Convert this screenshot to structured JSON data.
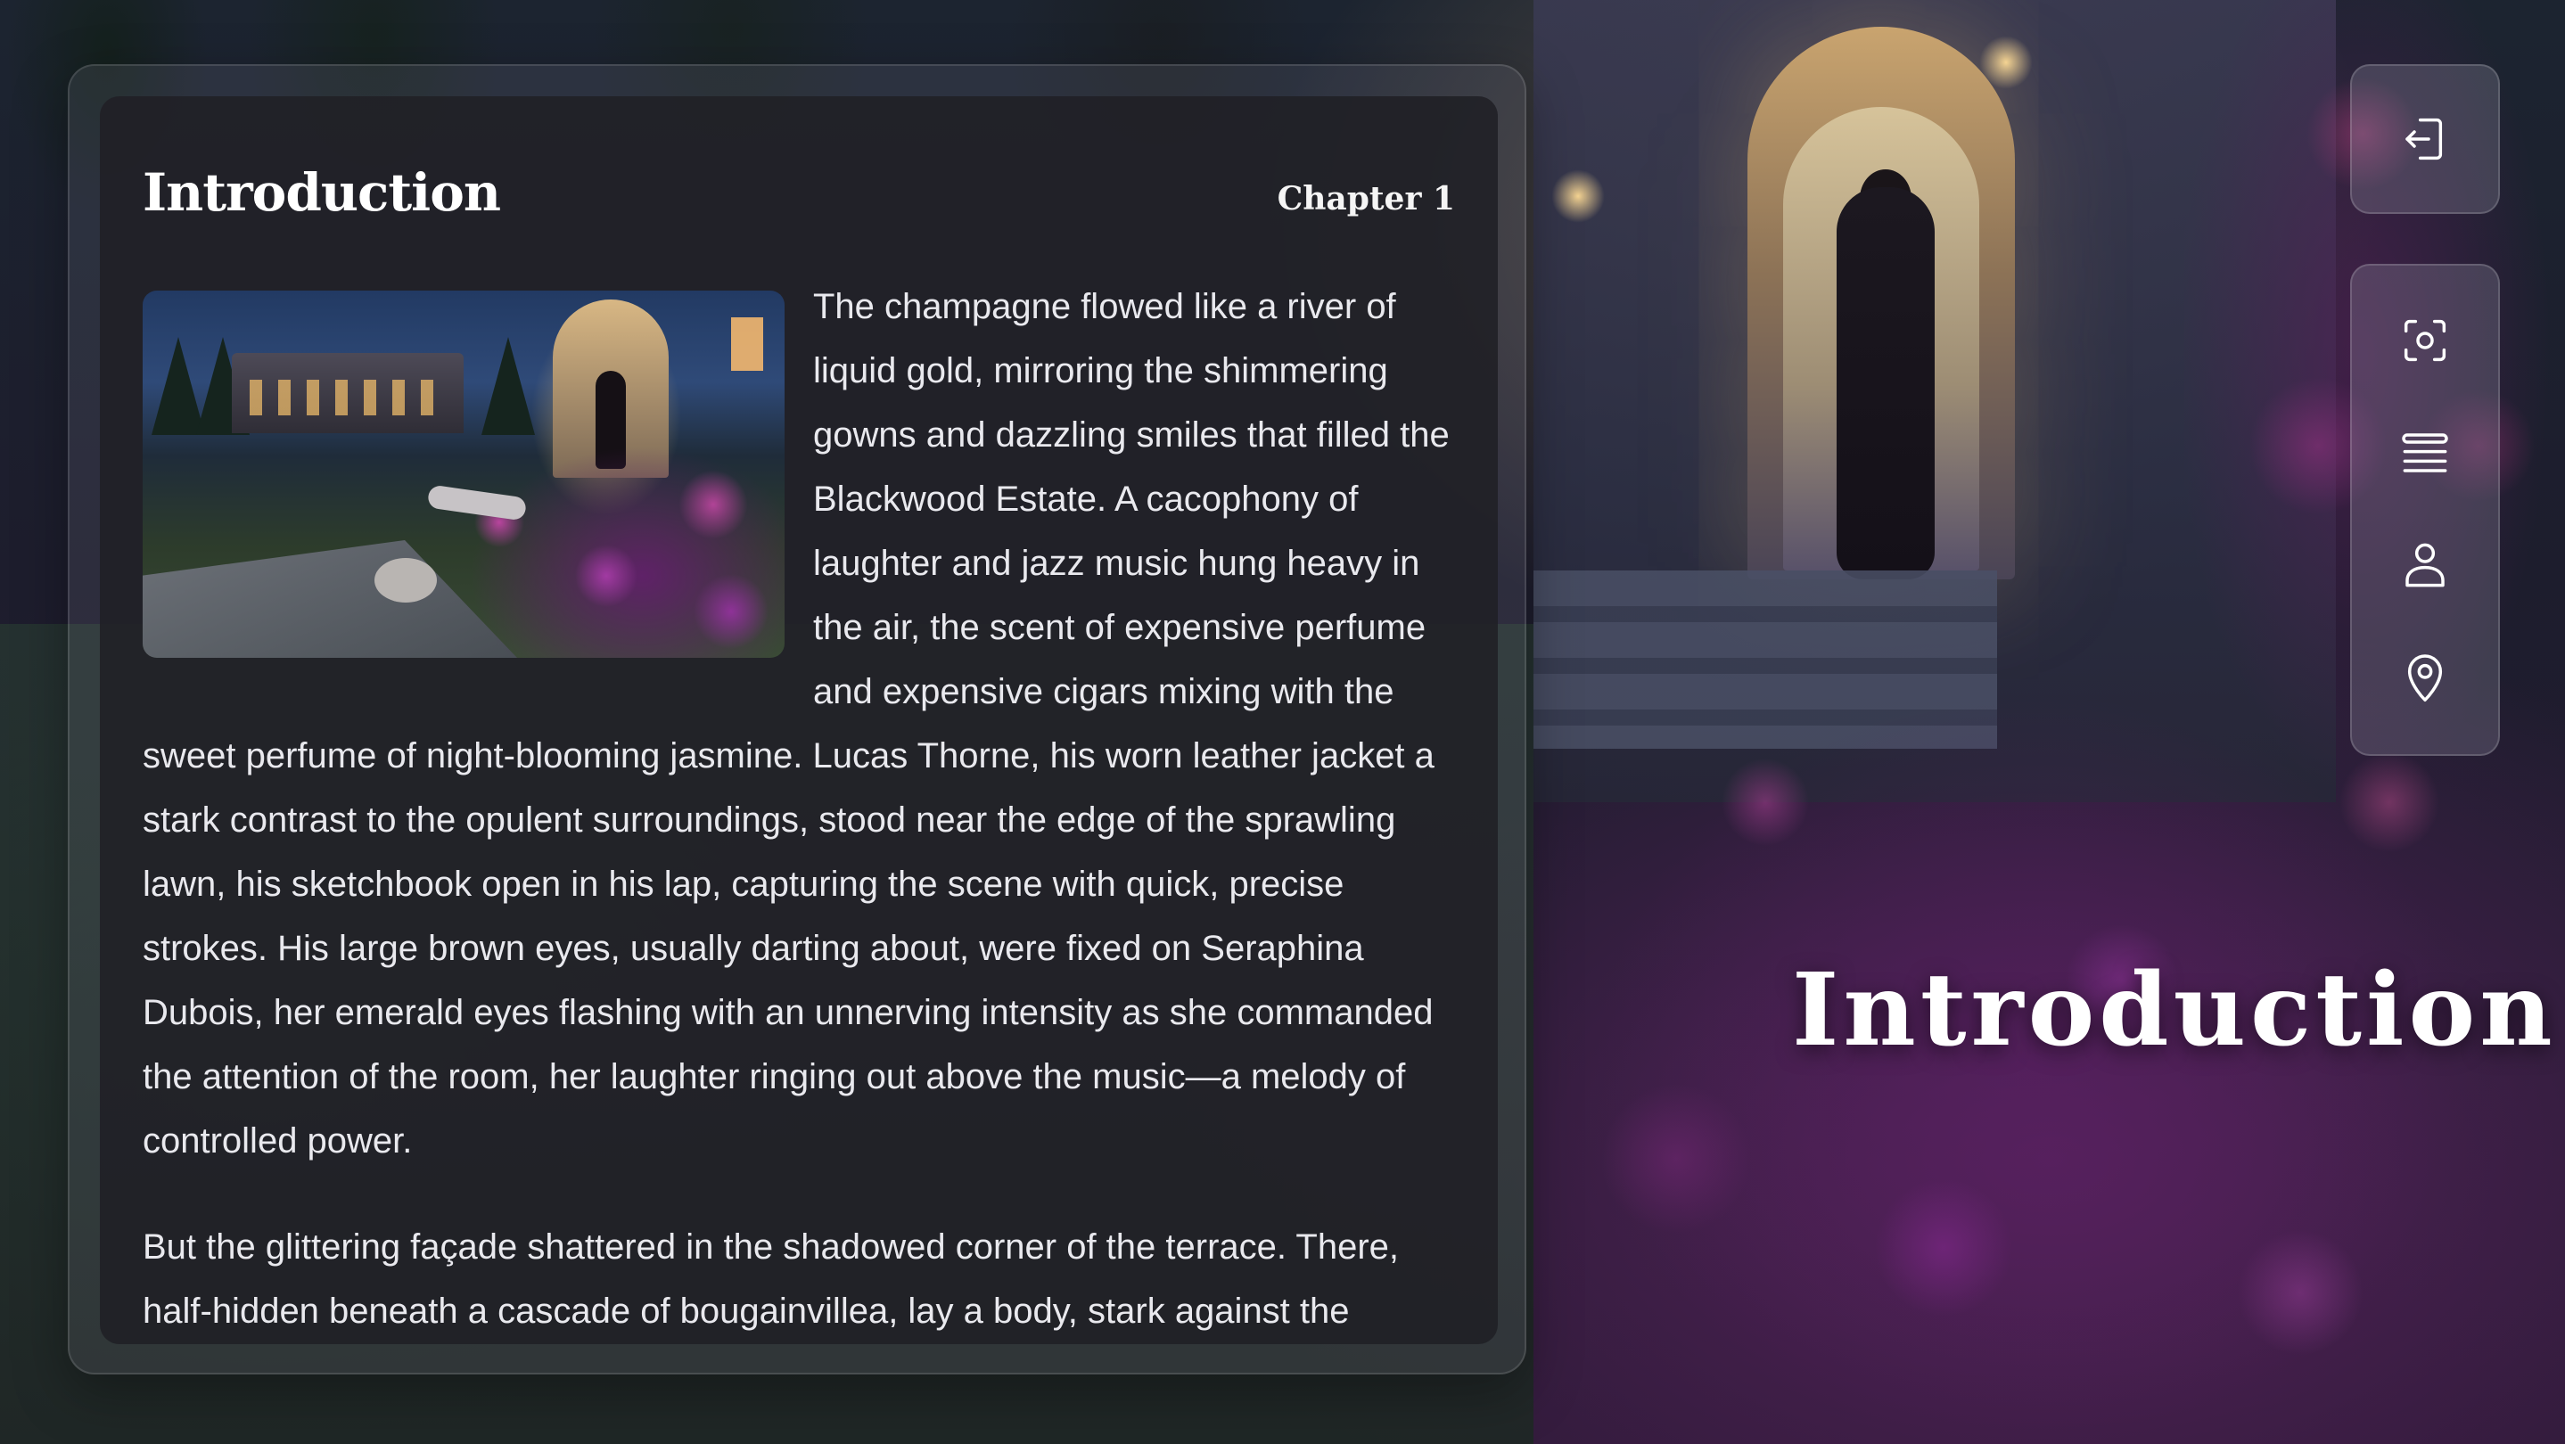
{
  "panel": {
    "title": "Introduction",
    "chapter": "Chapter 1",
    "paragraphs": [
      "The champagne flowed like a river of liquid gold, mirroring the shimmering gowns and dazzling smiles that filled the Blackwood Estate. A cacophony of laughter and jazz music hung heavy in the air, the scent of expensive perfume and expensive cigars mixing with the sweet perfume of night-blooming jasmine. Lucas Thorne, his worn leather jacket a stark contrast to the opulent surroundings, stood near the edge of the sprawling lawn, his sketchbook open in his lap, capturing the scene with quick, precise strokes. His large brown eyes, usually darting about, were fixed on Seraphina Dubois, her emerald eyes flashing with an unnerving intensity as she commanded the attention of the room, her laughter ringing out above the music—a melody of controlled power.",
      "But the glittering façade shattered in the shadowed corner of the terrace. There, half-hidden beneath a cascade of bougainvillea, lay a body, stark against the vibrant"
    ]
  },
  "hero": {
    "title": "Introduction"
  },
  "toolbar": {
    "exit_icon": "exit-icon",
    "tools": [
      {
        "icon": "screenshot-icon"
      },
      {
        "icon": "menu-icon"
      },
      {
        "icon": "user-icon"
      },
      {
        "icon": "location-pin-icon"
      }
    ]
  }
}
